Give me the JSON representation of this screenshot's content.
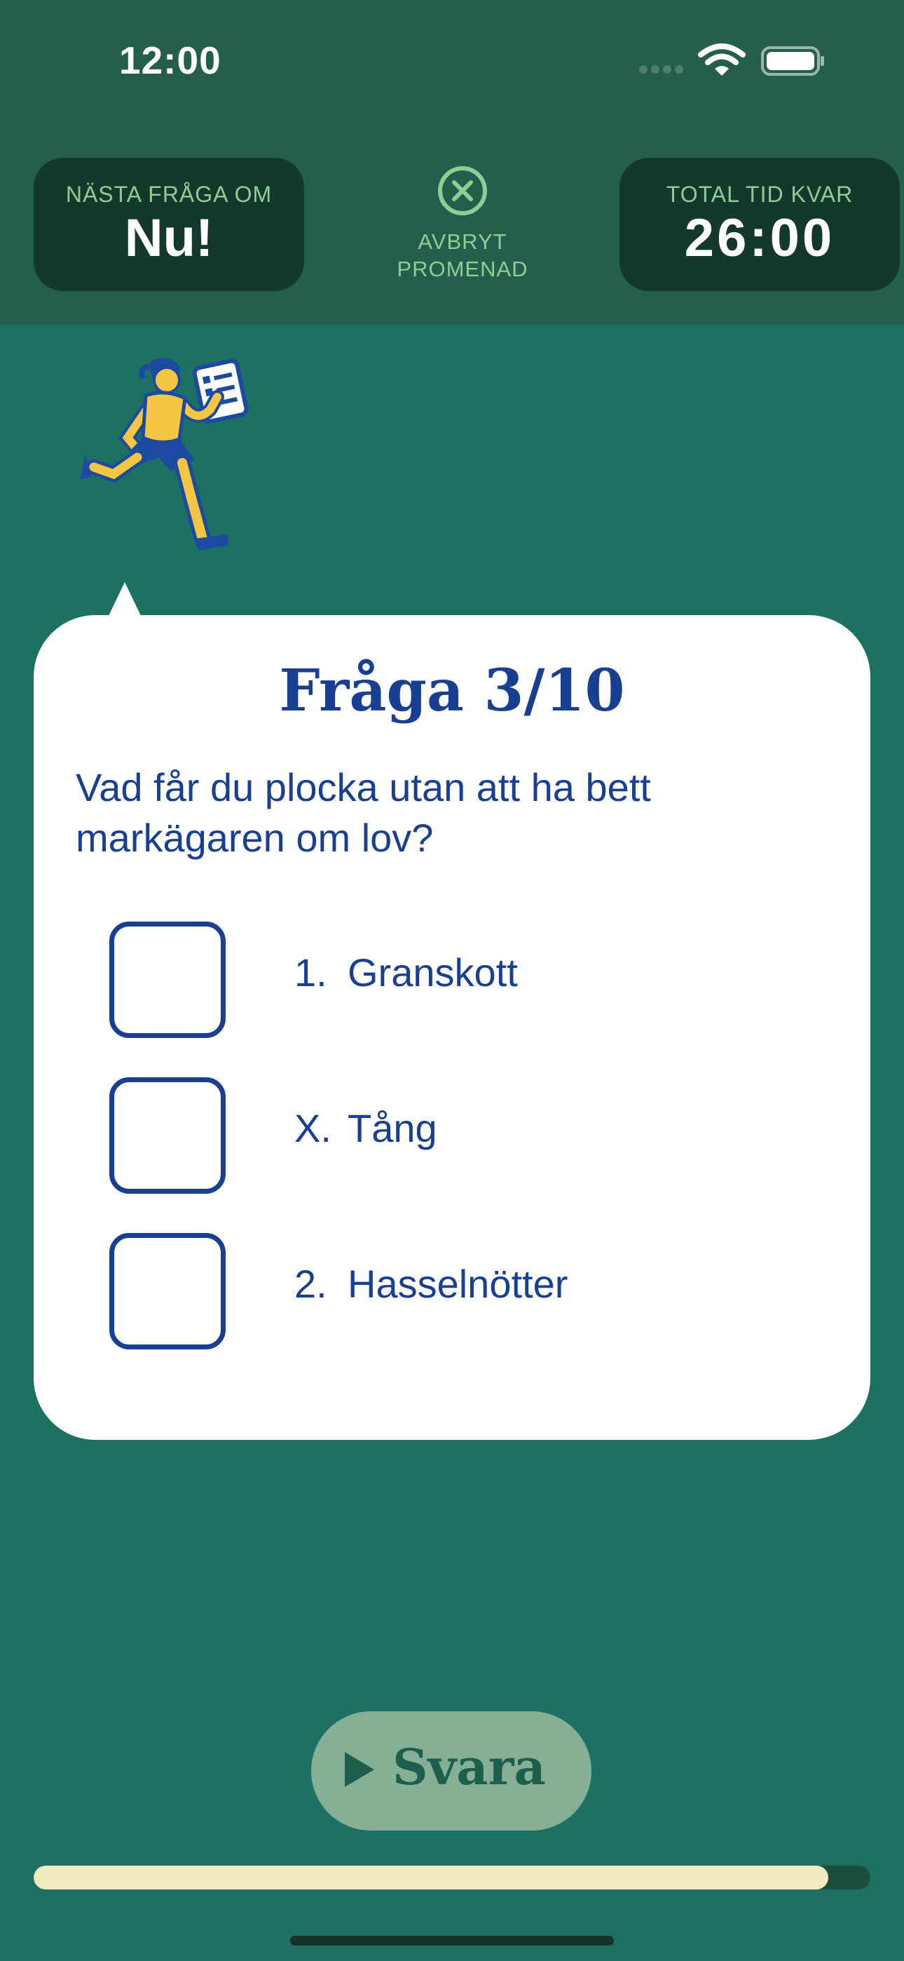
{
  "status_bar": {
    "time": "12:00",
    "icons": [
      "cellular-signal-icon",
      "wifi-icon",
      "battery-icon"
    ]
  },
  "header": {
    "next_question": {
      "label": "NÄSTA FRÅGA OM",
      "value": "Nu!"
    },
    "cancel": {
      "icon": "close-circle-icon",
      "label_line1": "AVBRYT",
      "label_line2": "PROMENAD"
    },
    "total_time": {
      "label": "TOTAL TID KVAR",
      "value": "26:00"
    }
  },
  "illustration": {
    "icon": "running-person-with-checklist"
  },
  "card": {
    "title": "Fråga 3/10",
    "question": "Vad får du plocka utan att ha bett markägaren om lov?",
    "options": [
      {
        "key": "1.",
        "label": "Granskott",
        "checked": false
      },
      {
        "key": "X.",
        "label": "Tång",
        "checked": false
      },
      {
        "key": "2.",
        "label": "Hasselnötter",
        "checked": false
      }
    ]
  },
  "answer_button": {
    "label": "Svara",
    "icon": "play-icon",
    "enabled": false
  },
  "progress": {
    "fraction": 0.95
  },
  "colors": {
    "background": "#1d7163",
    "header": "#245e4d",
    "timer_box": "#14372e",
    "accent_green": "#8dcf93",
    "text_blue": "#183f92",
    "button": "#86b095",
    "progress_fill": "#f2ebc2"
  }
}
